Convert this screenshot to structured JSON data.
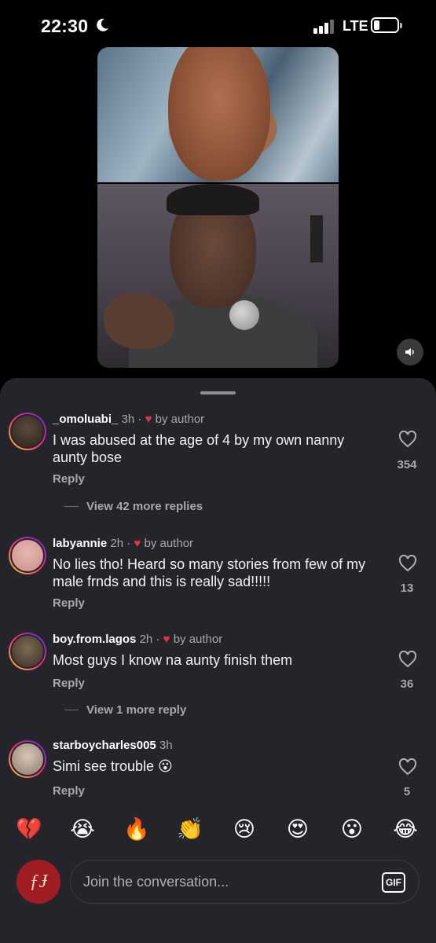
{
  "status_bar": {
    "time": "22:30",
    "network": "LTE"
  },
  "video": {
    "top_participant": "woman-headshot",
    "bottom_participant": "man-with-microphone"
  },
  "comments": [
    {
      "username": "_omoluabi_",
      "time": "3h",
      "liked_by_author": "by author",
      "text": "I was abused at the age of 4 by my own nanny aunty bose",
      "reply_label": "Reply",
      "likes": "354",
      "more_replies": "View 42 more replies"
    },
    {
      "username": "labyannie",
      "time": "2h",
      "liked_by_author": "by author",
      "text": "No lies tho! Heard so many stories from few of my male frnds and this is really sad!!!!!",
      "reply_label": "Reply",
      "likes": "13"
    },
    {
      "username": "boy.from.lagos",
      "time": "2h",
      "liked_by_author": "by author",
      "text": "Most guys I know na aunty finish them",
      "reply_label": "Reply",
      "likes": "36",
      "more_replies": "View 1 more reply"
    },
    {
      "username": "starboycharles005",
      "time": "3h",
      "text": "Simi see trouble 😮",
      "reply_label": "Reply",
      "likes": "5"
    }
  ],
  "emoji_reactions": [
    "💔",
    "😭",
    "🔥",
    "👏",
    "😢",
    "😍",
    "😮",
    "😂"
  ],
  "composer": {
    "avatar_initials": "ƒɈ",
    "placeholder": "Join the conversation...",
    "gif_label": "GIF"
  },
  "colors": {
    "sheet_bg": "#24252a",
    "heart_red": "#ed2f44",
    "profile_red": "#9e1c22"
  }
}
